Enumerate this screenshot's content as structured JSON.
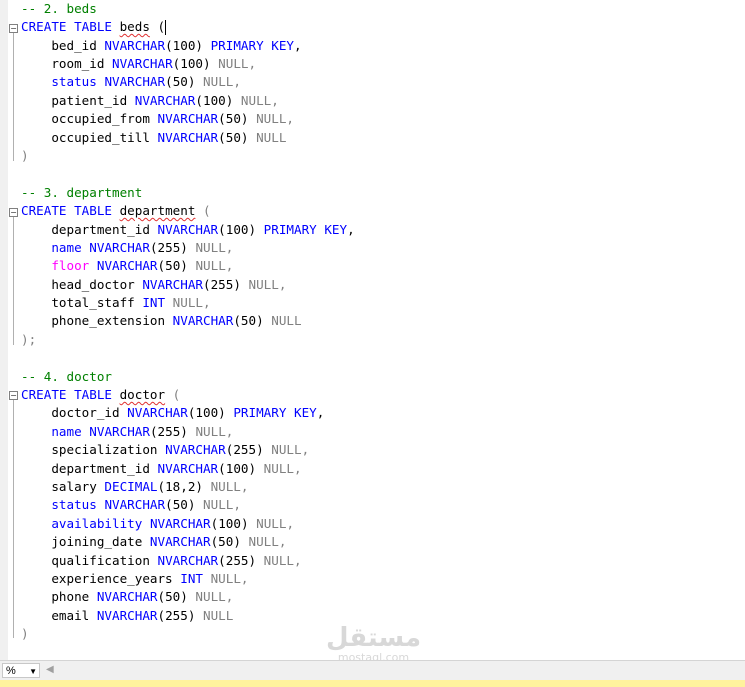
{
  "editor": {
    "lines": {
      "l1": [
        "-- 2. beds"
      ],
      "l2": [
        "CREATE TABLE ",
        "beds",
        " ("
      ],
      "l3": [
        "    bed_id ",
        "NVARCHAR",
        "(100) ",
        "PRIMARY KEY",
        ","
      ],
      "l4": [
        "    room_id ",
        "NVARCHAR",
        "(100) ",
        "NULL",
        ","
      ],
      "l5": [
        "    ",
        "status",
        " ",
        "NVARCHAR",
        "(50) ",
        "NULL",
        ","
      ],
      "l6": [
        "    patient_id ",
        "NVARCHAR",
        "(100) ",
        "NULL",
        ","
      ],
      "l7": [
        "    occupied_from ",
        "NVARCHAR",
        "(50) ",
        "NULL",
        ","
      ],
      "l8": [
        "    occupied_till ",
        "NVARCHAR",
        "(50) ",
        "NULL"
      ],
      "l9": [
        ")"
      ],
      "l10": [
        "-- 3. department"
      ],
      "l11": [
        "CREATE TABLE ",
        "department",
        " ("
      ],
      "l12": [
        "    department_id ",
        "NVARCHAR",
        "(100) ",
        "PRIMARY KEY",
        ","
      ],
      "l13": [
        "    ",
        "name",
        " ",
        "NVARCHAR",
        "(255) ",
        "NULL",
        ","
      ],
      "l14": [
        "    ",
        "floor",
        " ",
        "NVARCHAR",
        "(50) ",
        "NULL",
        ","
      ],
      "l15": [
        "    head_doctor ",
        "NVARCHAR",
        "(255) ",
        "NULL",
        ","
      ],
      "l16": [
        "    total_staff ",
        "INT",
        " ",
        "NULL",
        ","
      ],
      "l17": [
        "    phone_extension ",
        "NVARCHAR",
        "(50) ",
        "NULL"
      ],
      "l18": [
        ");"
      ],
      "l19": [
        "-- 4. doctor"
      ],
      "l20": [
        "CREATE TABLE ",
        "doctor",
        " ("
      ],
      "l21": [
        "    doctor_id ",
        "NVARCHAR",
        "(100) ",
        "PRIMARY KEY",
        ","
      ],
      "l22": [
        "    ",
        "name",
        " ",
        "NVARCHAR",
        "(255) ",
        "NULL",
        ","
      ],
      "l23": [
        "    specialization ",
        "NVARCHAR",
        "(255) ",
        "NULL",
        ","
      ],
      "l24": [
        "    department_id ",
        "NVARCHAR",
        "(100) ",
        "NULL",
        ","
      ],
      "l25": [
        "    salary ",
        "DECIMAL",
        "(18,2) ",
        "NULL",
        ","
      ],
      "l26": [
        "    ",
        "status",
        " ",
        "NVARCHAR",
        "(50) ",
        "NULL",
        ","
      ],
      "l27": [
        "    ",
        "availability",
        " ",
        "NVARCHAR",
        "(100) ",
        "NULL",
        ","
      ],
      "l28": [
        "    joining_date ",
        "NVARCHAR",
        "(50) ",
        "NULL",
        ","
      ],
      "l29": [
        "    qualification ",
        "NVARCHAR",
        "(255) ",
        "NULL",
        ","
      ],
      "l30": [
        "    experience_years ",
        "INT",
        " ",
        "NULL",
        ","
      ],
      "l31": [
        "    phone ",
        "NVARCHAR",
        "(50) ",
        "NULL",
        ","
      ],
      "l32": [
        "    email ",
        "NVARCHAR",
        "(255) ",
        "NULL"
      ],
      "l33": [
        ")"
      ]
    }
  },
  "status_bar": {
    "zoom_label": "%"
  },
  "watermark": {
    "brand": "مستقل",
    "domain": "mostaql.com"
  },
  "colors": {
    "keyword": "#0000ff",
    "comment": "#008000",
    "null": "#808080",
    "function": "#ff00ff",
    "status_yellow": "#fff29d"
  }
}
